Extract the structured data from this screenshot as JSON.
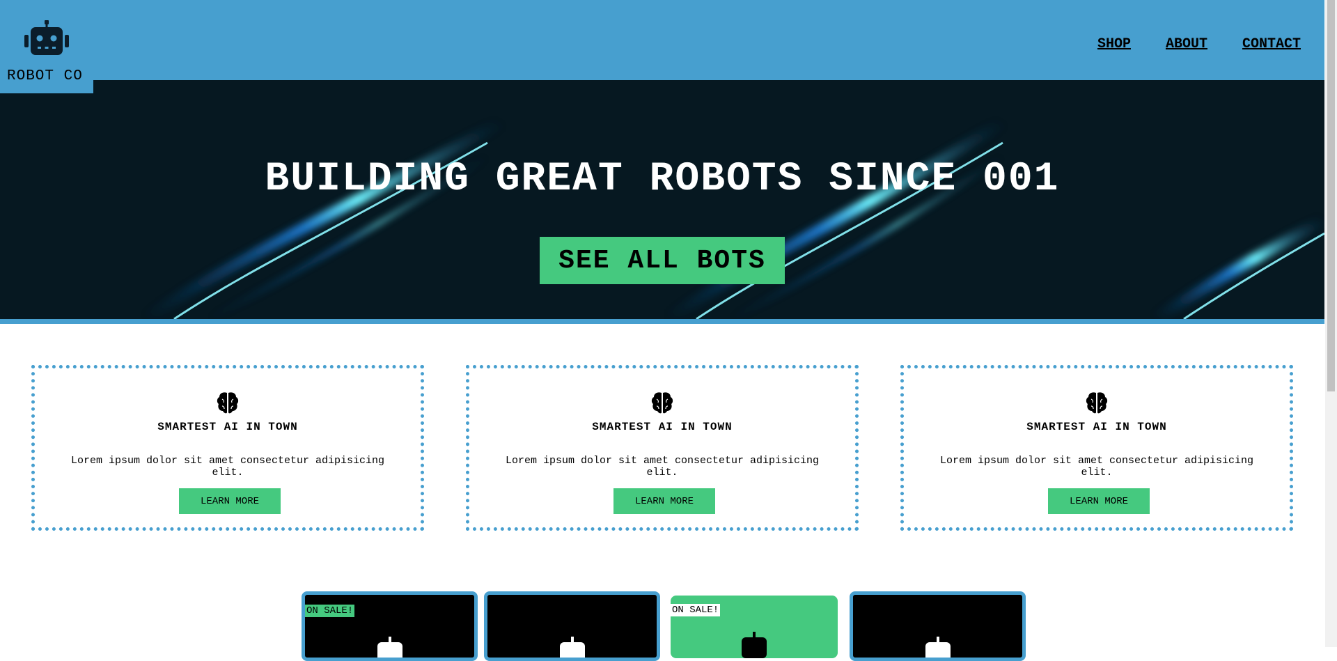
{
  "brand": {
    "name": "ROBOT CO",
    "icon": "robot-icon"
  },
  "nav": {
    "items": [
      "SHOP",
      "ABOUT",
      "CONTACT"
    ]
  },
  "hero": {
    "title": "BUILDING GREAT ROBOTS SINCE 001",
    "cta": "SEE ALL BOTS"
  },
  "features": [
    {
      "icon": "brain-icon",
      "title": "SMARTEST AI IN TOWN",
      "text": "Lorem ipsum dolor sit amet consectetur adipisicing elit.",
      "button": "LEARN MORE"
    },
    {
      "icon": "brain-icon",
      "title": "SMARTEST AI IN TOWN",
      "text": "Lorem ipsum dolor sit amet consectetur adipisicing elit.",
      "button": "LEARN MORE"
    },
    {
      "icon": "brain-icon",
      "title": "SMARTEST AI IN TOWN",
      "text": "Lorem ipsum dolor sit amet consectetur adipisicing elit.",
      "button": "LEARN MORE"
    }
  ],
  "products": [
    {
      "badge": "ON SALE!",
      "style": "dark"
    },
    {
      "badge": "",
      "style": "dark"
    },
    {
      "badge": "ON SALE!",
      "style": "green"
    },
    {
      "badge": "",
      "style": "dark"
    }
  ],
  "colors": {
    "primary": "#479fcf",
    "accent": "#45c97f",
    "hero_bg": "#061821"
  }
}
